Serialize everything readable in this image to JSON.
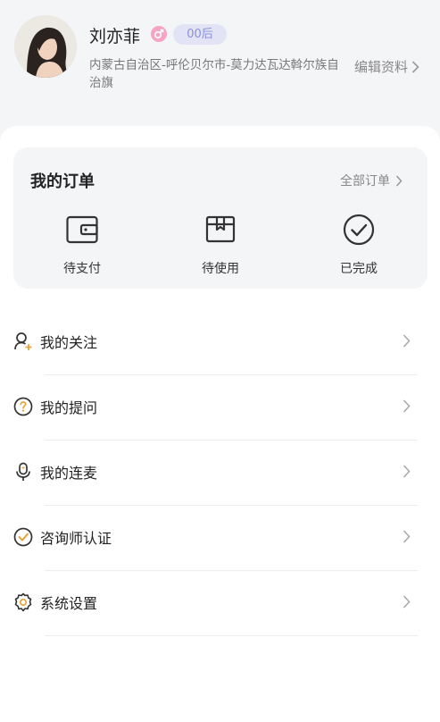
{
  "profile": {
    "name": "刘亦菲",
    "age_badge": "00后",
    "location": "内蒙古自治区-呼伦贝尔市-莫力达瓦达斡尔族自治旗",
    "edit_label": "编辑资料",
    "gender_color": "#f7a3c4"
  },
  "orders": {
    "title": "我的订单",
    "all_label": "全部订单",
    "items": [
      {
        "label": "待支付",
        "icon": "wallet-icon"
      },
      {
        "label": "待使用",
        "icon": "package-icon"
      },
      {
        "label": "已完成",
        "icon": "check-circle-icon"
      }
    ]
  },
  "menu": [
    {
      "label": "我的关注",
      "icon": "user-plus-icon",
      "accent": "#333"
    },
    {
      "label": "我的提问",
      "icon": "question-icon",
      "accent": "#e8a33a"
    },
    {
      "label": "我的连麦",
      "icon": "mic-icon",
      "accent": "#333"
    },
    {
      "label": "咨询师认证",
      "icon": "verified-icon",
      "accent": "#e8a33a"
    },
    {
      "label": "系统设置",
      "icon": "gear-icon",
      "accent": "#333"
    }
  ]
}
